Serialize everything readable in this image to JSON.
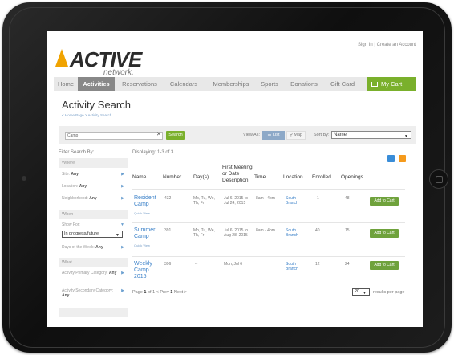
{
  "header": {
    "logo_text": "ACTIVE",
    "logo_sub": "network.",
    "sign_in": "Sign In",
    "separator": "|",
    "create_account": "Create an Account"
  },
  "nav": {
    "items": [
      "Home",
      "Activities",
      "Reservations",
      "Calendars",
      "Memberships",
      "Sports",
      "Donations",
      "Gift Card"
    ],
    "active": "Activities",
    "cart_label": "My Cart"
  },
  "page": {
    "title": "Activity Search",
    "breadcrumb": "< Home Page > Activity Search"
  },
  "search": {
    "value": "Camp",
    "clear": "✕",
    "button": "Search",
    "view_as_label": "View As:",
    "list_label": "List",
    "map_label": "Map",
    "sort_label": "Sort By:",
    "sort_value": "Name"
  },
  "filters": {
    "title": "Filter Search By:",
    "where_head": "Where",
    "site_label": "Site:",
    "site_value": "Any",
    "location_label": "Location:",
    "location_value": "Any",
    "neighborhood_label": "Neighborhood:",
    "neighborhood_value": "Any",
    "when_head": "When",
    "show_for_label": "Show For:",
    "show_for_value": "In progress/future",
    "days_label": "Days of the Week:",
    "days_value": "Any",
    "what_head": "What",
    "primary_label": "Activity Primary Category:",
    "primary_value": "Any",
    "secondary_label": "Activity Secondary Category:",
    "secondary_value": "Any"
  },
  "results": {
    "displaying": "Displaying: 1-3 of 3",
    "columns": [
      "Name",
      "Number",
      "Day(s)",
      "First Meeting or Date Description",
      "Time",
      "Location",
      "Enrolled",
      "Openings"
    ],
    "rows": [
      {
        "name": "Resident Camp",
        "quick": "Quick View",
        "number": "432",
        "days": "Mo, Tu, We, Th, Fr",
        "date": "Jul 6, 2015 to Jul 24, 2015",
        "time": "8am - 4pm",
        "location": "South Branch",
        "enrolled": "1",
        "openings": "48",
        "button": "Add to Cart"
      },
      {
        "name": "Summer Camp",
        "quick": "Quick View",
        "number": "391",
        "days": "Mo, Tu, We, Th, Fr",
        "date": "Jul 6, 2015 to Aug 28, 2015",
        "time": "8am - 4pm",
        "location": "South Branch",
        "enrolled": "40",
        "openings": "15",
        "button": "Add to Cart"
      },
      {
        "name": "Weekly Camp 2015",
        "quick": "",
        "number": "396",
        "days": "--",
        "date": "Mon, Jul 6",
        "time": "",
        "location": "South Branch",
        "enrolled": "12",
        "openings": "24",
        "button": "Add to Cart"
      }
    ],
    "pager_text": "Page",
    "page_current": "1",
    "page_of": "of 1 < Prev",
    "page_num": "1",
    "page_next": "Next >",
    "per_page_value": "20",
    "per_page_label": "results per page"
  },
  "colors": {
    "accent_green": "#7ab02c",
    "link_blue": "#3a80c8",
    "logo_orange": "#f0a300"
  }
}
